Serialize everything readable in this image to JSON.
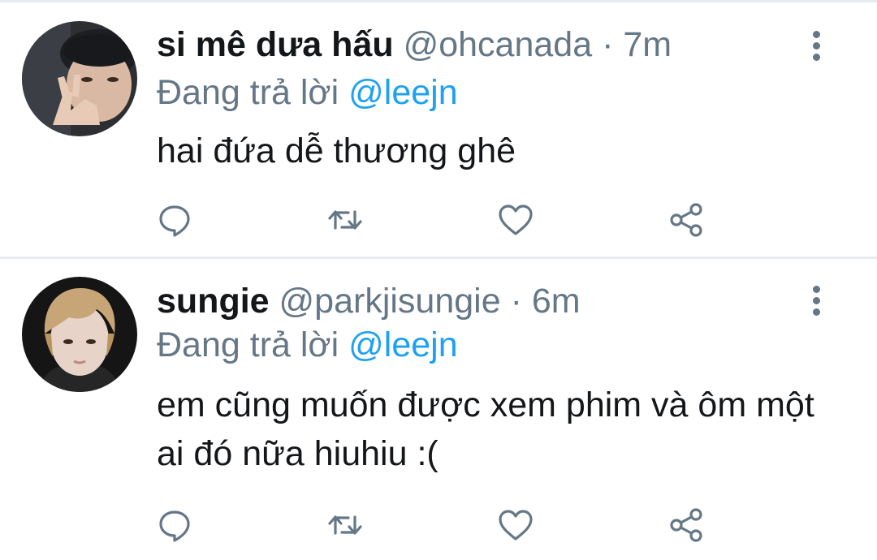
{
  "tweets": [
    {
      "display_name": "si mê dưa hấu",
      "handle": "@ohcanada",
      "separator": "·",
      "time": "7m",
      "reply_prefix": "Đang trả lời",
      "reply_to": "@leejn",
      "body": "hai đứa dễ thương ghê"
    },
    {
      "display_name": "sungie",
      "handle": "@parkjisungie",
      "separator": "·",
      "time": "6m",
      "reply_prefix": "Đang trả lời",
      "reply_to": "@leejn",
      "body": "em cũng muốn được xem phim và ôm một ai đó nữa hiuhiu :("
    }
  ],
  "icons": {
    "more": "more-vertical-icon",
    "reply": "reply-icon",
    "retweet": "retweet-icon",
    "like": "heart-icon",
    "share": "share-icon"
  },
  "colors": {
    "text_primary": "#14171a",
    "text_secondary": "#657786",
    "mention": "#1da1f2",
    "divider": "#e6ecf0"
  }
}
